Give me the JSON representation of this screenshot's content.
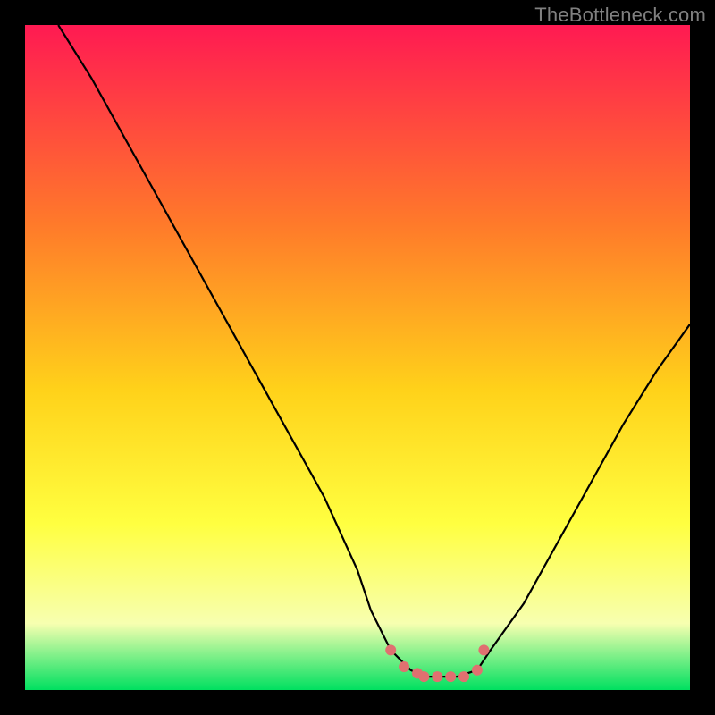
{
  "watermark": "TheBottleneck.com",
  "colors": {
    "background": "#000000",
    "gradient_top": "#ff1a52",
    "gradient_mid1": "#ff7a2a",
    "gradient_mid2": "#ffd21a",
    "gradient_mid3": "#ffff40",
    "gradient_mid4": "#f7ffb0",
    "gradient_bottom": "#00e060",
    "curve": "#000000",
    "marker": "#e07070"
  },
  "chart_data": {
    "type": "line",
    "title": "",
    "xlabel": "",
    "ylabel": "",
    "xlim": [
      0,
      100
    ],
    "ylim": [
      0,
      100
    ],
    "series": [
      {
        "name": "bottleneck-curve",
        "x": [
          5,
          10,
          15,
          20,
          25,
          30,
          35,
          40,
          45,
          50,
          52,
          55,
          58,
          60,
          62,
          65,
          68,
          70,
          75,
          80,
          85,
          90,
          95,
          100
        ],
        "y": [
          100,
          92,
          83,
          74,
          65,
          56,
          47,
          38,
          29,
          18,
          12,
          6,
          3,
          2,
          2,
          2,
          3,
          6,
          13,
          22,
          31,
          40,
          48,
          55
        ]
      }
    ],
    "markers": {
      "name": "optimal-zone-markers",
      "x": [
        55,
        57,
        59,
        60,
        62,
        64,
        66,
        68,
        69
      ],
      "y": [
        6,
        3.5,
        2.5,
        2,
        2,
        2,
        2,
        3,
        6
      ]
    }
  }
}
